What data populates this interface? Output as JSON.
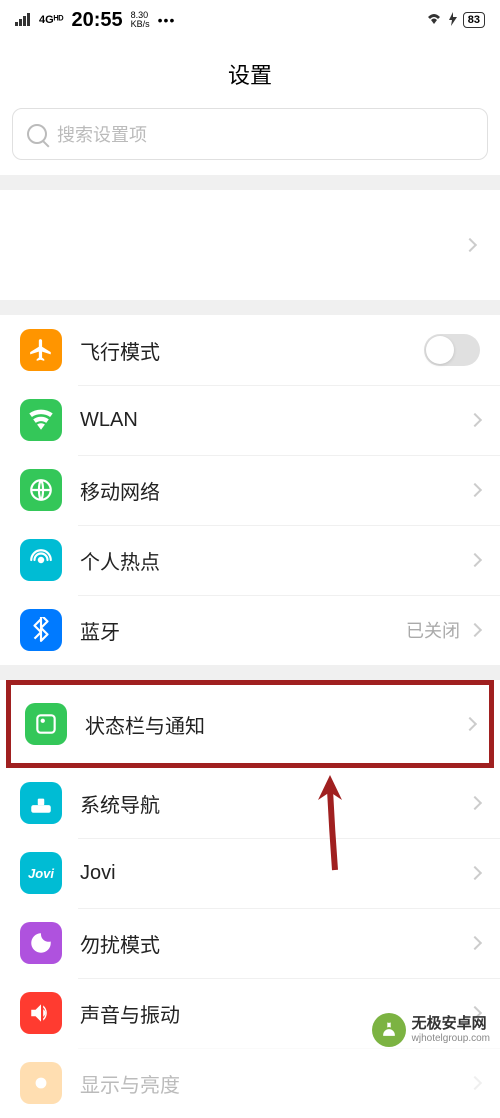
{
  "status_bar": {
    "signal": "4Gᴴᴰ",
    "time": "20:55",
    "net_speed_top": "8.30",
    "net_speed_bot": "KB/s",
    "dots": "•••",
    "battery": "83"
  },
  "header": {
    "title": "设置"
  },
  "search": {
    "placeholder": "搜索设置项"
  },
  "rows": {
    "airplane": {
      "label": "飞行模式"
    },
    "wlan": {
      "label": "WLAN"
    },
    "mobile_network": {
      "label": "移动网络"
    },
    "hotspot": {
      "label": "个人热点"
    },
    "bluetooth": {
      "label": "蓝牙",
      "value": "已关闭"
    },
    "status_notif": {
      "label": "状态栏与通知"
    },
    "navigation": {
      "label": "系统导航"
    },
    "jovi": {
      "label": "Jovi"
    },
    "dnd": {
      "label": "勿扰模式"
    },
    "sound": {
      "label": "声音与振动"
    },
    "display": {
      "label": "显示与亮度"
    }
  },
  "icon_colors": {
    "airplane": "#ff9500",
    "wlan": "#34c759",
    "mobile_network": "#34c759",
    "hotspot": "#00bcd4",
    "bluetooth": "#007aff",
    "status_notif": "#34c759",
    "navigation": "#00bcd4",
    "jovi": "#00bcd4",
    "dnd": "#af52de",
    "sound": "#ff3b30",
    "display": "#ff9500"
  },
  "watermark": {
    "name": "无极安卓网",
    "url": "wjhotelgroup.com"
  }
}
